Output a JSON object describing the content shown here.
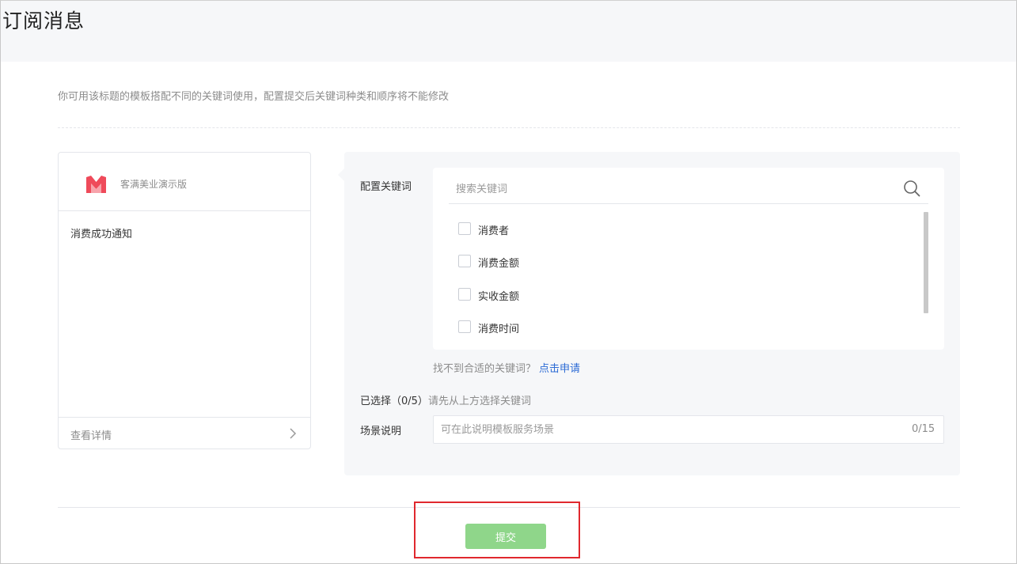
{
  "page": {
    "title": "订阅消息"
  },
  "tip": "你可用该标题的模板搭配不同的关键词使用，配置提交后关键词种类和顺序将不能修改",
  "preview": {
    "brand_name": "客满美业演示版",
    "message_title": "消费成功通知",
    "detail_label": "查看详情",
    "logo_icon": "brand-logo-icon",
    "arrow_icon": "chevron-right-icon"
  },
  "config": {
    "keywords_label": "配置关键词",
    "search_placeholder": "搜索关键词",
    "search_icon": "search-icon",
    "keywords": [
      {
        "label": "消费者",
        "checked": false
      },
      {
        "label": "消费金额",
        "checked": false
      },
      {
        "label": "实收金额",
        "checked": false
      },
      {
        "label": "消费时间",
        "checked": false
      }
    ],
    "not_found_text": "找不到合适的关键词？",
    "apply_link": "点击申请",
    "selected_label": "已选择（0/5）",
    "selected_hint": "请先从上方选择关键词",
    "scene_label": "场景说明",
    "scene_placeholder": "可在此说明模板服务场景",
    "scene_counter": "0/15"
  },
  "actions": {
    "submit_label": "提交"
  },
  "colors": {
    "accent_link": "#2c6bd5",
    "submit_bg": "#8fd68a",
    "highlight_border": "#e0282e",
    "logo": "#ef4a5a"
  }
}
